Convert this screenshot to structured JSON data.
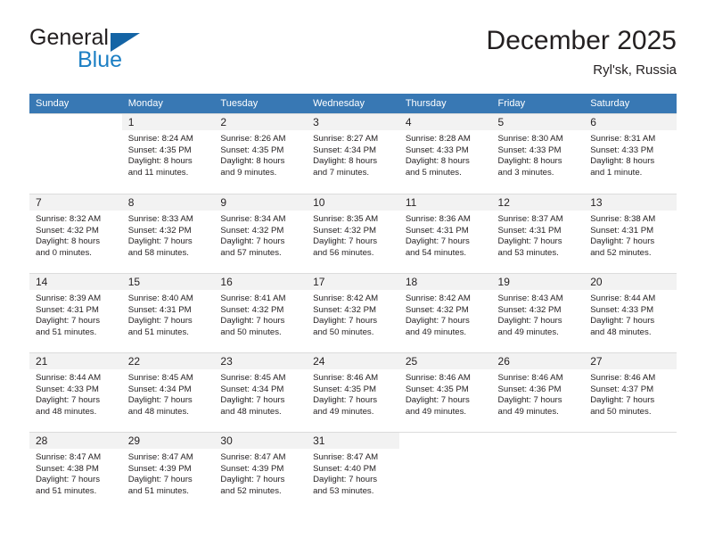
{
  "brand": {
    "word1": "General",
    "word2": "Blue",
    "flag_color": "#1464a5",
    "blue_color": "#1c7fc4"
  },
  "header": {
    "title": "December 2025",
    "location": "Ryl'sk, Russia"
  },
  "theme": {
    "header_row_bg": "#3878b4",
    "daynum_bg": "#f2f2f2",
    "grid_line": "#dcdcdc"
  },
  "weekdays": [
    "Sunday",
    "Monday",
    "Tuesday",
    "Wednesday",
    "Thursday",
    "Friday",
    "Saturday"
  ],
  "weeks": [
    [
      {
        "day": "",
        "l1": "",
        "l2": "",
        "l3": "",
        "l4": ""
      },
      {
        "day": "1",
        "l1": "Sunrise: 8:24 AM",
        "l2": "Sunset: 4:35 PM",
        "l3": "Daylight: 8 hours",
        "l4": "and 11 minutes."
      },
      {
        "day": "2",
        "l1": "Sunrise: 8:26 AM",
        "l2": "Sunset: 4:35 PM",
        "l3": "Daylight: 8 hours",
        "l4": "and 9 minutes."
      },
      {
        "day": "3",
        "l1": "Sunrise: 8:27 AM",
        "l2": "Sunset: 4:34 PM",
        "l3": "Daylight: 8 hours",
        "l4": "and 7 minutes."
      },
      {
        "day": "4",
        "l1": "Sunrise: 8:28 AM",
        "l2": "Sunset: 4:33 PM",
        "l3": "Daylight: 8 hours",
        "l4": "and 5 minutes."
      },
      {
        "day": "5",
        "l1": "Sunrise: 8:30 AM",
        "l2": "Sunset: 4:33 PM",
        "l3": "Daylight: 8 hours",
        "l4": "and 3 minutes."
      },
      {
        "day": "6",
        "l1": "Sunrise: 8:31 AM",
        "l2": "Sunset: 4:33 PM",
        "l3": "Daylight: 8 hours",
        "l4": "and 1 minute."
      }
    ],
    [
      {
        "day": "7",
        "l1": "Sunrise: 8:32 AM",
        "l2": "Sunset: 4:32 PM",
        "l3": "Daylight: 8 hours",
        "l4": "and 0 minutes."
      },
      {
        "day": "8",
        "l1": "Sunrise: 8:33 AM",
        "l2": "Sunset: 4:32 PM",
        "l3": "Daylight: 7 hours",
        "l4": "and 58 minutes."
      },
      {
        "day": "9",
        "l1": "Sunrise: 8:34 AM",
        "l2": "Sunset: 4:32 PM",
        "l3": "Daylight: 7 hours",
        "l4": "and 57 minutes."
      },
      {
        "day": "10",
        "l1": "Sunrise: 8:35 AM",
        "l2": "Sunset: 4:32 PM",
        "l3": "Daylight: 7 hours",
        "l4": "and 56 minutes."
      },
      {
        "day": "11",
        "l1": "Sunrise: 8:36 AM",
        "l2": "Sunset: 4:31 PM",
        "l3": "Daylight: 7 hours",
        "l4": "and 54 minutes."
      },
      {
        "day": "12",
        "l1": "Sunrise: 8:37 AM",
        "l2": "Sunset: 4:31 PM",
        "l3": "Daylight: 7 hours",
        "l4": "and 53 minutes."
      },
      {
        "day": "13",
        "l1": "Sunrise: 8:38 AM",
        "l2": "Sunset: 4:31 PM",
        "l3": "Daylight: 7 hours",
        "l4": "and 52 minutes."
      }
    ],
    [
      {
        "day": "14",
        "l1": "Sunrise: 8:39 AM",
        "l2": "Sunset: 4:31 PM",
        "l3": "Daylight: 7 hours",
        "l4": "and 51 minutes."
      },
      {
        "day": "15",
        "l1": "Sunrise: 8:40 AM",
        "l2": "Sunset: 4:31 PM",
        "l3": "Daylight: 7 hours",
        "l4": "and 51 minutes."
      },
      {
        "day": "16",
        "l1": "Sunrise: 8:41 AM",
        "l2": "Sunset: 4:32 PM",
        "l3": "Daylight: 7 hours",
        "l4": "and 50 minutes."
      },
      {
        "day": "17",
        "l1": "Sunrise: 8:42 AM",
        "l2": "Sunset: 4:32 PM",
        "l3": "Daylight: 7 hours",
        "l4": "and 50 minutes."
      },
      {
        "day": "18",
        "l1": "Sunrise: 8:42 AM",
        "l2": "Sunset: 4:32 PM",
        "l3": "Daylight: 7 hours",
        "l4": "and 49 minutes."
      },
      {
        "day": "19",
        "l1": "Sunrise: 8:43 AM",
        "l2": "Sunset: 4:32 PM",
        "l3": "Daylight: 7 hours",
        "l4": "and 49 minutes."
      },
      {
        "day": "20",
        "l1": "Sunrise: 8:44 AM",
        "l2": "Sunset: 4:33 PM",
        "l3": "Daylight: 7 hours",
        "l4": "and 48 minutes."
      }
    ],
    [
      {
        "day": "21",
        "l1": "Sunrise: 8:44 AM",
        "l2": "Sunset: 4:33 PM",
        "l3": "Daylight: 7 hours",
        "l4": "and 48 minutes."
      },
      {
        "day": "22",
        "l1": "Sunrise: 8:45 AM",
        "l2": "Sunset: 4:34 PM",
        "l3": "Daylight: 7 hours",
        "l4": "and 48 minutes."
      },
      {
        "day": "23",
        "l1": "Sunrise: 8:45 AM",
        "l2": "Sunset: 4:34 PM",
        "l3": "Daylight: 7 hours",
        "l4": "and 48 minutes."
      },
      {
        "day": "24",
        "l1": "Sunrise: 8:46 AM",
        "l2": "Sunset: 4:35 PM",
        "l3": "Daylight: 7 hours",
        "l4": "and 49 minutes."
      },
      {
        "day": "25",
        "l1": "Sunrise: 8:46 AM",
        "l2": "Sunset: 4:35 PM",
        "l3": "Daylight: 7 hours",
        "l4": "and 49 minutes."
      },
      {
        "day": "26",
        "l1": "Sunrise: 8:46 AM",
        "l2": "Sunset: 4:36 PM",
        "l3": "Daylight: 7 hours",
        "l4": "and 49 minutes."
      },
      {
        "day": "27",
        "l1": "Sunrise: 8:46 AM",
        "l2": "Sunset: 4:37 PM",
        "l3": "Daylight: 7 hours",
        "l4": "and 50 minutes."
      }
    ],
    [
      {
        "day": "28",
        "l1": "Sunrise: 8:47 AM",
        "l2": "Sunset: 4:38 PM",
        "l3": "Daylight: 7 hours",
        "l4": "and 51 minutes."
      },
      {
        "day": "29",
        "l1": "Sunrise: 8:47 AM",
        "l2": "Sunset: 4:39 PM",
        "l3": "Daylight: 7 hours",
        "l4": "and 51 minutes."
      },
      {
        "day": "30",
        "l1": "Sunrise: 8:47 AM",
        "l2": "Sunset: 4:39 PM",
        "l3": "Daylight: 7 hours",
        "l4": "and 52 minutes."
      },
      {
        "day": "31",
        "l1": "Sunrise: 8:47 AM",
        "l2": "Sunset: 4:40 PM",
        "l3": "Daylight: 7 hours",
        "l4": "and 53 minutes."
      },
      {
        "day": "",
        "l1": "",
        "l2": "",
        "l3": "",
        "l4": ""
      },
      {
        "day": "",
        "l1": "",
        "l2": "",
        "l3": "",
        "l4": ""
      },
      {
        "day": "",
        "l1": "",
        "l2": "",
        "l3": "",
        "l4": ""
      }
    ]
  ]
}
